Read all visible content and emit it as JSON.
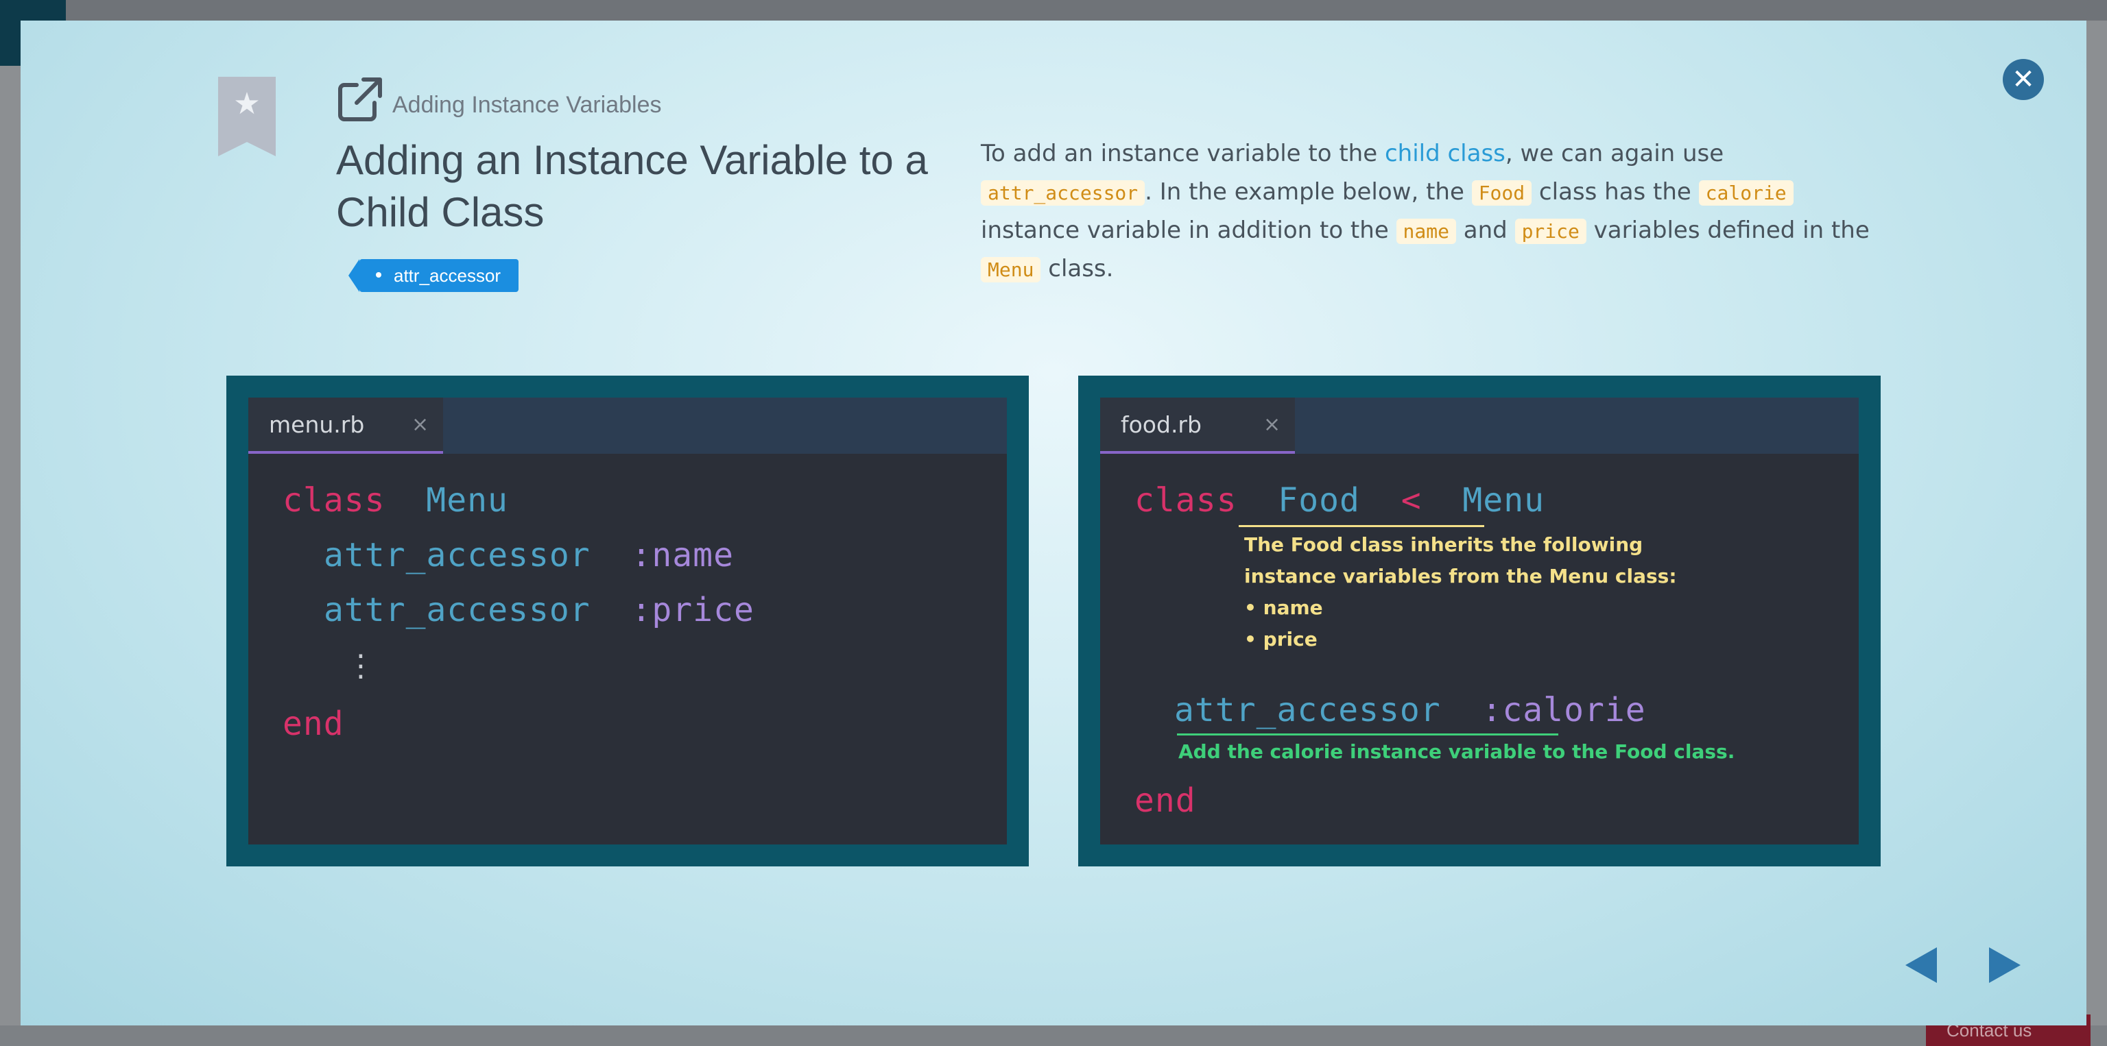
{
  "modal": {
    "subtitle": "Adding Instance Variables",
    "title": "Adding an Instance Variable to a Child Class",
    "tag": "attr_accessor",
    "close_icon": "close-icon",
    "bookmark_icon": "bookmark-star-icon",
    "external_icon": "external-link-icon",
    "description": {
      "t1": "To add an instance variable to the ",
      "link": "child class",
      "t2": ", we can again use ",
      "c1": "attr_accessor",
      "t3": ". In the example below, the ",
      "c2": "Food",
      "t4": " class has the ",
      "c3": "calorie",
      "t5": " instance variable in addition to the ",
      "c4": "name",
      "t6": " and ",
      "c5": "price",
      "t7": " variables defined in the ",
      "c6": "Menu",
      "t8": " class."
    }
  },
  "left_editor": {
    "tab": "menu.rb",
    "tab_close": "×",
    "kw_class": "class",
    "class_name": "Menu",
    "acc1": "attr_accessor",
    "sym1": ":name",
    "acc2": "attr_accessor",
    "sym2": ":price",
    "dots": "⋮",
    "kw_end": "end"
  },
  "right_editor": {
    "tab": "food.rb",
    "tab_close": "×",
    "kw_class": "class",
    "class_name": "Food",
    "op": "<",
    "parent": "Menu",
    "note_lines": [
      "The Food class inherits the following",
      "instance variables from the Menu class:",
      "• name",
      "• price"
    ],
    "acc": "attr_accessor",
    "sym": ":calorie",
    "note_green": "Add the calorie instance variable to the Food class.",
    "kw_end": "end"
  },
  "background": {
    "contact": "Contact us"
  },
  "colors": {
    "accent": "#1b8ee0",
    "panel": "#0c5567",
    "keyword": "#d8326a",
    "class": "#4fa3c6",
    "symbol": "#a688db",
    "note_yellow": "#f4e08a",
    "note_green": "#3ed07a"
  }
}
